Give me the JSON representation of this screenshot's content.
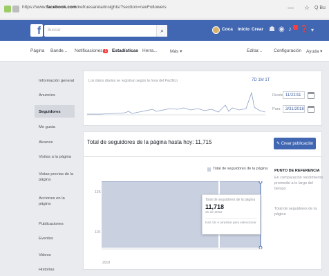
{
  "browser": {
    "url_prefix": "https://www.",
    "url_domain": "facebook.com",
    "url_rest": "/nefruesarela/insights/?section=navFollowers",
    "right_icons": [
      "—",
      "☆",
      "Q Bu"
    ]
  },
  "fb_header": {
    "logo": "f",
    "search_placeholder": "Buscar",
    "nav": [
      "Coca",
      "Inicio",
      "Crear"
    ]
  },
  "page_tabs": [
    {
      "label": "Página",
      "active": false
    },
    {
      "label": "Bande...",
      "active": false
    },
    {
      "label": "Notificaciones",
      "active": false,
      "badge": "1"
    },
    {
      "label": "Estadísticas",
      "active": true
    },
    {
      "label": "Herra...",
      "active": false
    },
    {
      "label": "Más ▾",
      "active": false
    },
    {
      "label": "Editar...",
      "active": false
    },
    {
      "label": "Configuración",
      "active": false
    },
    {
      "label": "Ayuda ▾",
      "active": false
    }
  ],
  "sidebar": [
    {
      "label": "Información general",
      "active": false
    },
    {
      "label": "Anuncios",
      "active": false
    },
    {
      "label": "Seguidores",
      "active": true
    },
    {
      "label": "Me gusta",
      "active": false
    },
    {
      "label": "Alcance",
      "active": false
    },
    {
      "label": "Visitas a la página",
      "active": false
    },
    {
      "label": "Vistas previas de la página",
      "active": false
    },
    {
      "label": "Acciones en la página",
      "active": false
    },
    {
      "label": "Publicaciones",
      "active": false
    },
    {
      "label": "Eventos",
      "active": false
    },
    {
      "label": "Videos",
      "active": false
    },
    {
      "label": "Historias",
      "active": false
    }
  ],
  "overview": {
    "note": "Los datos diarios se registran según la hora del Pacífico",
    "presets": "7D  1M  1T",
    "from_label": "Desde",
    "from_value": "11/22/11",
    "to_label": "Para",
    "to_value": "3/31/2018"
  },
  "followers": {
    "title": "Total de seguidores de la página hasta hoy: 11,715",
    "create_button": "Crear publicación",
    "legend": "Total de seguidores de la página",
    "reference_title": "PUNTO DE REFERENCIA",
    "reference_text": "En comparación rendimiento promedio a lo largo del tiempo",
    "reference_sub": "Total de seguidores de la página",
    "y_ticks": [
      "12K",
      "11K"
    ],
    "x_tick_year": "2018",
    "tooltip": {
      "label": "Total de seguidores de la página",
      "value": "11,718",
      "date": "31 de 2018",
      "link": "Haz clic e arrastrar para seleccionar"
    }
  },
  "colors": {
    "fb_blue": "#4267b2",
    "chart_fill": "#c9d0e0",
    "chart_line": "#8b9dc3"
  },
  "chart_data": {
    "type": "area",
    "series": [
      {
        "name": "Total de seguidores de la página",
        "values": [
          11650,
          11660,
          11665,
          11670,
          11675,
          11680,
          11685,
          11690,
          11695,
          11700,
          11705,
          11708,
          11712,
          11715,
          11718
        ]
      }
    ],
    "ylabel": "",
    "xlabel": ""
  }
}
